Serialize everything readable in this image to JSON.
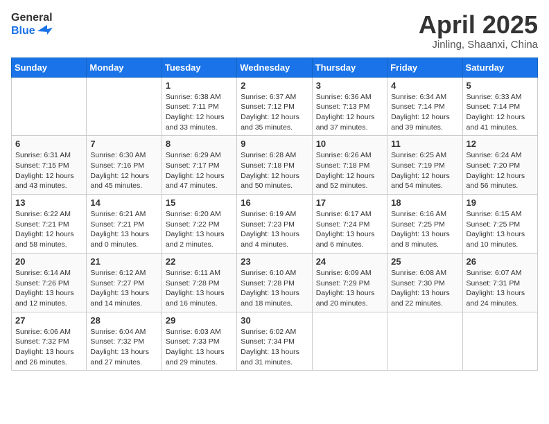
{
  "header": {
    "logo_general": "General",
    "logo_blue": "Blue",
    "month_title": "April 2025",
    "location": "Jinling, Shaanxi, China"
  },
  "days_of_week": [
    "Sunday",
    "Monday",
    "Tuesday",
    "Wednesday",
    "Thursday",
    "Friday",
    "Saturday"
  ],
  "weeks": [
    [
      {
        "day": "",
        "info": ""
      },
      {
        "day": "",
        "info": ""
      },
      {
        "day": "1",
        "info": "Sunrise: 6:38 AM\nSunset: 7:11 PM\nDaylight: 12 hours and 33 minutes."
      },
      {
        "day": "2",
        "info": "Sunrise: 6:37 AM\nSunset: 7:12 PM\nDaylight: 12 hours and 35 minutes."
      },
      {
        "day": "3",
        "info": "Sunrise: 6:36 AM\nSunset: 7:13 PM\nDaylight: 12 hours and 37 minutes."
      },
      {
        "day": "4",
        "info": "Sunrise: 6:34 AM\nSunset: 7:14 PM\nDaylight: 12 hours and 39 minutes."
      },
      {
        "day": "5",
        "info": "Sunrise: 6:33 AM\nSunset: 7:14 PM\nDaylight: 12 hours and 41 minutes."
      }
    ],
    [
      {
        "day": "6",
        "info": "Sunrise: 6:31 AM\nSunset: 7:15 PM\nDaylight: 12 hours and 43 minutes."
      },
      {
        "day": "7",
        "info": "Sunrise: 6:30 AM\nSunset: 7:16 PM\nDaylight: 12 hours and 45 minutes."
      },
      {
        "day": "8",
        "info": "Sunrise: 6:29 AM\nSunset: 7:17 PM\nDaylight: 12 hours and 47 minutes."
      },
      {
        "day": "9",
        "info": "Sunrise: 6:28 AM\nSunset: 7:18 PM\nDaylight: 12 hours and 50 minutes."
      },
      {
        "day": "10",
        "info": "Sunrise: 6:26 AM\nSunset: 7:18 PM\nDaylight: 12 hours and 52 minutes."
      },
      {
        "day": "11",
        "info": "Sunrise: 6:25 AM\nSunset: 7:19 PM\nDaylight: 12 hours and 54 minutes."
      },
      {
        "day": "12",
        "info": "Sunrise: 6:24 AM\nSunset: 7:20 PM\nDaylight: 12 hours and 56 minutes."
      }
    ],
    [
      {
        "day": "13",
        "info": "Sunrise: 6:22 AM\nSunset: 7:21 PM\nDaylight: 12 hours and 58 minutes."
      },
      {
        "day": "14",
        "info": "Sunrise: 6:21 AM\nSunset: 7:21 PM\nDaylight: 13 hours and 0 minutes."
      },
      {
        "day": "15",
        "info": "Sunrise: 6:20 AM\nSunset: 7:22 PM\nDaylight: 13 hours and 2 minutes."
      },
      {
        "day": "16",
        "info": "Sunrise: 6:19 AM\nSunset: 7:23 PM\nDaylight: 13 hours and 4 minutes."
      },
      {
        "day": "17",
        "info": "Sunrise: 6:17 AM\nSunset: 7:24 PM\nDaylight: 13 hours and 6 minutes."
      },
      {
        "day": "18",
        "info": "Sunrise: 6:16 AM\nSunset: 7:25 PM\nDaylight: 13 hours and 8 minutes."
      },
      {
        "day": "19",
        "info": "Sunrise: 6:15 AM\nSunset: 7:25 PM\nDaylight: 13 hours and 10 minutes."
      }
    ],
    [
      {
        "day": "20",
        "info": "Sunrise: 6:14 AM\nSunset: 7:26 PM\nDaylight: 13 hours and 12 minutes."
      },
      {
        "day": "21",
        "info": "Sunrise: 6:12 AM\nSunset: 7:27 PM\nDaylight: 13 hours and 14 minutes."
      },
      {
        "day": "22",
        "info": "Sunrise: 6:11 AM\nSunset: 7:28 PM\nDaylight: 13 hours and 16 minutes."
      },
      {
        "day": "23",
        "info": "Sunrise: 6:10 AM\nSunset: 7:28 PM\nDaylight: 13 hours and 18 minutes."
      },
      {
        "day": "24",
        "info": "Sunrise: 6:09 AM\nSunset: 7:29 PM\nDaylight: 13 hours and 20 minutes."
      },
      {
        "day": "25",
        "info": "Sunrise: 6:08 AM\nSunset: 7:30 PM\nDaylight: 13 hours and 22 minutes."
      },
      {
        "day": "26",
        "info": "Sunrise: 6:07 AM\nSunset: 7:31 PM\nDaylight: 13 hours and 24 minutes."
      }
    ],
    [
      {
        "day": "27",
        "info": "Sunrise: 6:06 AM\nSunset: 7:32 PM\nDaylight: 13 hours and 26 minutes."
      },
      {
        "day": "28",
        "info": "Sunrise: 6:04 AM\nSunset: 7:32 PM\nDaylight: 13 hours and 27 minutes."
      },
      {
        "day": "29",
        "info": "Sunrise: 6:03 AM\nSunset: 7:33 PM\nDaylight: 13 hours and 29 minutes."
      },
      {
        "day": "30",
        "info": "Sunrise: 6:02 AM\nSunset: 7:34 PM\nDaylight: 13 hours and 31 minutes."
      },
      {
        "day": "",
        "info": ""
      },
      {
        "day": "",
        "info": ""
      },
      {
        "day": "",
        "info": ""
      }
    ]
  ]
}
